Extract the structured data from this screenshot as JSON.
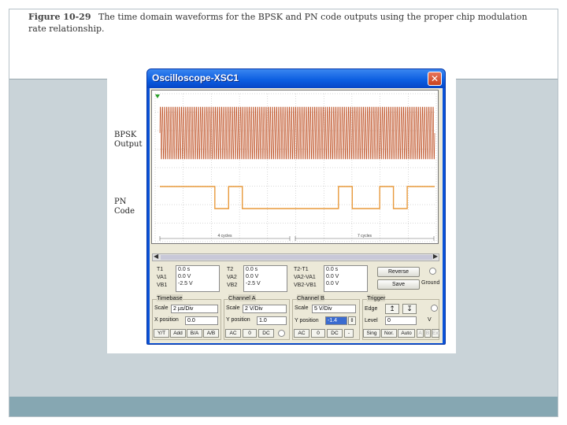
{
  "caption": {
    "figure": "Figure 10-29",
    "text": "The time domain waveforms for the BPSK and PN code outputs using the proper chip modulation rate relationship."
  },
  "labels": {
    "bpsk": [
      "BPSK",
      "Output"
    ],
    "pn": [
      "PN",
      "Code"
    ]
  },
  "window": {
    "title": "Oscilloscope-XSC1",
    "close_glyph": "✕"
  },
  "screen": {
    "cycle_labels": [
      "4 cycles",
      "7 cycles"
    ]
  },
  "readout": {
    "t1": {
      "label": "T1",
      "rows": [
        [
          "",
          "0.0 s"
        ],
        [
          "VA1",
          "0.0 V"
        ],
        [
          "VB1",
          "-2.5 V"
        ]
      ]
    },
    "t2": {
      "label": "T2",
      "rows": [
        [
          "",
          "0.0 s"
        ],
        [
          "VA2",
          "0.0 V"
        ],
        [
          "VB2",
          "-2.5 V"
        ]
      ]
    },
    "t21": {
      "label": "T2-T1",
      "rows": [
        [
          "",
          "0.0 s"
        ],
        [
          "VA2-VA1",
          "0.0 V"
        ],
        [
          "VB2-VB1",
          "0.0 V"
        ]
      ]
    },
    "reverse_label": "Reverse",
    "save_label": "Save",
    "ground_label": "Ground"
  },
  "timebase": {
    "header": "Timebase",
    "scale_label": "Scale",
    "scale_value": "2 µs/Div",
    "xpos_label": "X position",
    "xpos_value": "0.0",
    "buttons": [
      "Y/T",
      "Add",
      "B/A",
      "A/B"
    ]
  },
  "channel_a": {
    "header": "Channel A",
    "scale_label": "Scale",
    "scale_value": "2 V/Div",
    "ypos_label": "Y position",
    "ypos_value": "1.0",
    "buttons": [
      "AC",
      "0",
      "DC"
    ]
  },
  "channel_b": {
    "header": "Channel B",
    "scale_label": "Scale",
    "scale_value": "5 V/Div",
    "ypos_label": "Y position",
    "ypos_value": "-1.4",
    "buttons": [
      "AC",
      "0",
      "DC",
      "-"
    ]
  },
  "trigger": {
    "header": "Trigger",
    "edge_label": "Edge",
    "level_label": "Level",
    "level_value": "0",
    "level_unit": "V",
    "buttons": [
      "Sing",
      "Nor.",
      "Auto"
    ],
    "source_buttons": [
      "A",
      "B",
      "Ext"
    ]
  },
  "colors": {
    "bpsk_trace": "#c0552a",
    "pn_trace": "#e89a3c",
    "grid": "#b0b0b0",
    "titlebar": "#0a5ce0"
  },
  "pn_code": {
    "chip_levels": [
      1,
      1,
      1,
      1,
      0,
      1,
      0,
      0,
      0,
      0,
      0,
      0,
      0,
      1,
      0,
      0,
      1,
      0,
      1,
      1
    ]
  }
}
